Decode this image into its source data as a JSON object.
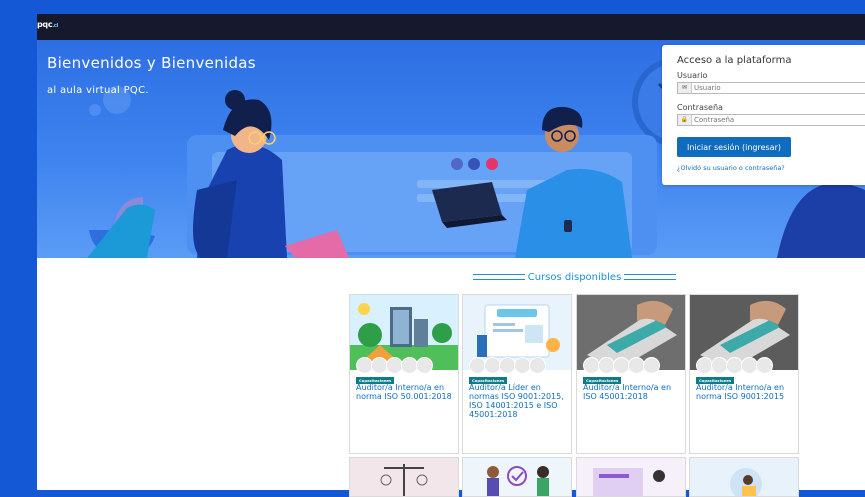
{
  "brand": {
    "logo_main": "pqc",
    "logo_suffix": ".cl"
  },
  "hero": {
    "title": "Bienvenidos y Bienvenidas",
    "subtitle": "al aula virtual PQC."
  },
  "login": {
    "title": "Acceso a la plataforma",
    "username_label": "Usuario",
    "username_placeholder": "Usuario",
    "password_label": "Contraseña",
    "password_placeholder": "Contraseña",
    "submit_label": "Iniciar sesión (ingresar)",
    "forgot_link": "¿Olvidó su usuario o contraseña?"
  },
  "courses": {
    "section_title": "Cursos disponibles",
    "items": [
      {
        "category": "Capacitaciones",
        "title": "Auditor/a Interno/a en norma ISO 50.001:2018"
      },
      {
        "category": "Capacitaciones",
        "title": "Auditor/a Líder en normas ISO 9001:2015, ISO 14001:2015 e ISO 45001:2018"
      },
      {
        "category": "Capacitaciones",
        "title": "Auditor/a Interno/a en ISO 45001:2018"
      },
      {
        "category": "Capacitaciones",
        "title": "Auditor/a Interno/a en norma ISO 9001:2015"
      }
    ]
  },
  "colors": {
    "accent": "#0f6cbf",
    "background": "#1558d6",
    "topbar": "#16192c",
    "badge": "#0e7c86"
  }
}
